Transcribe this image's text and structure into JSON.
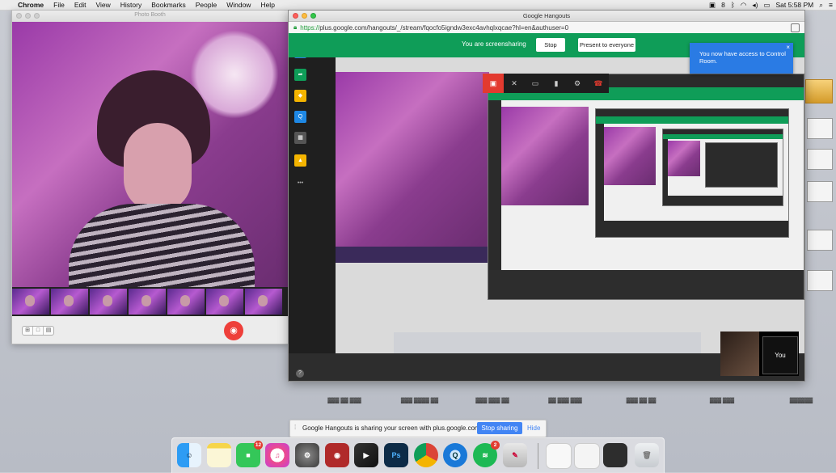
{
  "menubar": {
    "app": "Chrome",
    "items": [
      "File",
      "Edit",
      "View",
      "History",
      "Bookmarks",
      "People",
      "Window",
      "Help"
    ],
    "status_badge": "8",
    "battery": "100%",
    "clock": "Sat 5:58 PM"
  },
  "photo_booth": {
    "title": "Photo Booth"
  },
  "chrome": {
    "title": "Google Hangouts",
    "url_scheme": "https://",
    "url_rest": "plus.google.com/hangouts/_/stream/fqocfo5igndw3exc4avhqlxqcae?hl=en&authuser=0",
    "share_message": "You are screensharing",
    "stop_label": "Stop",
    "present_label": "Present to everyone",
    "notification": "You now have access to Control Room.",
    "self_view_label": "You"
  },
  "share_notice": {
    "text": "Google Hangouts is sharing your screen with plus.google.com.",
    "stop_sharing": "Stop sharing",
    "hide": "Hide"
  },
  "dock": {
    "messages_badge": "12",
    "spotify_badge": "2",
    "apps": [
      "finder-icon",
      "notes-icon",
      "facetime-icon",
      "itunes-icon",
      "system-preferences-icon",
      "photo-booth-icon",
      "final-cut-icon",
      "photoshop-icon",
      "chrome-icon",
      "quicktime-icon",
      "spotify-icon",
      "preview-icon"
    ]
  },
  "colors": {
    "hangouts_green": "#0f9d58",
    "notification_blue": "#2a7be4",
    "stop_sharing_blue": "#4285f4",
    "record_red": "#ee3f3a"
  }
}
